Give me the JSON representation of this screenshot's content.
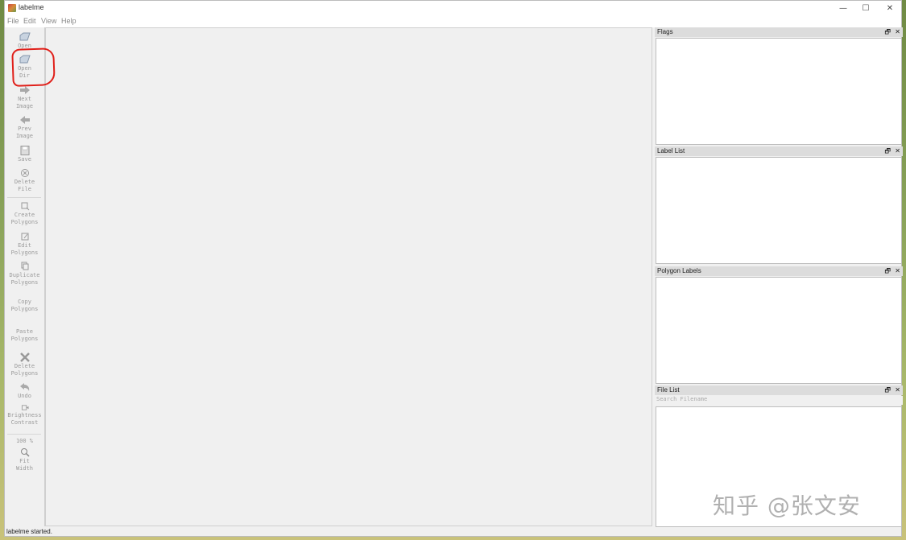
{
  "window": {
    "title": "labelme",
    "minimize": "—",
    "maximize": "☐",
    "close": "✕"
  },
  "menu": [
    "File",
    "Edit",
    "View",
    "Help"
  ],
  "toolbar": {
    "open": "Open",
    "open_dir": [
      "Open",
      "Dir"
    ],
    "next_image": [
      "Next",
      "Image"
    ],
    "prev_image": [
      "Prev",
      "Image"
    ],
    "save": "Save",
    "delete_file": [
      "Delete",
      "File"
    ],
    "create_polygons": [
      "Create",
      "Polygons"
    ],
    "edit_polygons": [
      "Edit",
      "Polygons"
    ],
    "duplicate_polygons": [
      "Duplicate",
      "Polygons"
    ],
    "copy_polygons": [
      "Copy",
      "Polygons"
    ],
    "paste_polygons": [
      "Paste",
      "Polygons"
    ],
    "delete_polygons": [
      "Delete",
      "Polygons"
    ],
    "undo": "Undo",
    "brightness_contrast": [
      "Brightness",
      "Contrast"
    ],
    "zoom": "100 %",
    "fit_width": [
      "Fit",
      "Width"
    ]
  },
  "docks": {
    "flags": "Flags",
    "label_list": "Label List",
    "polygon_labels": "Polygon Labels",
    "file_list": "File List",
    "float_glyph": "🗗",
    "close_glyph": "✕"
  },
  "file_list": {
    "search_placeholder": "Search Filename"
  },
  "status": "labelme started.",
  "watermark": "知乎 @张文安",
  "colors": {
    "annotation": "#e0201a",
    "window_bg": "#f0f0f0",
    "dock_header": "#dcdcdc"
  }
}
